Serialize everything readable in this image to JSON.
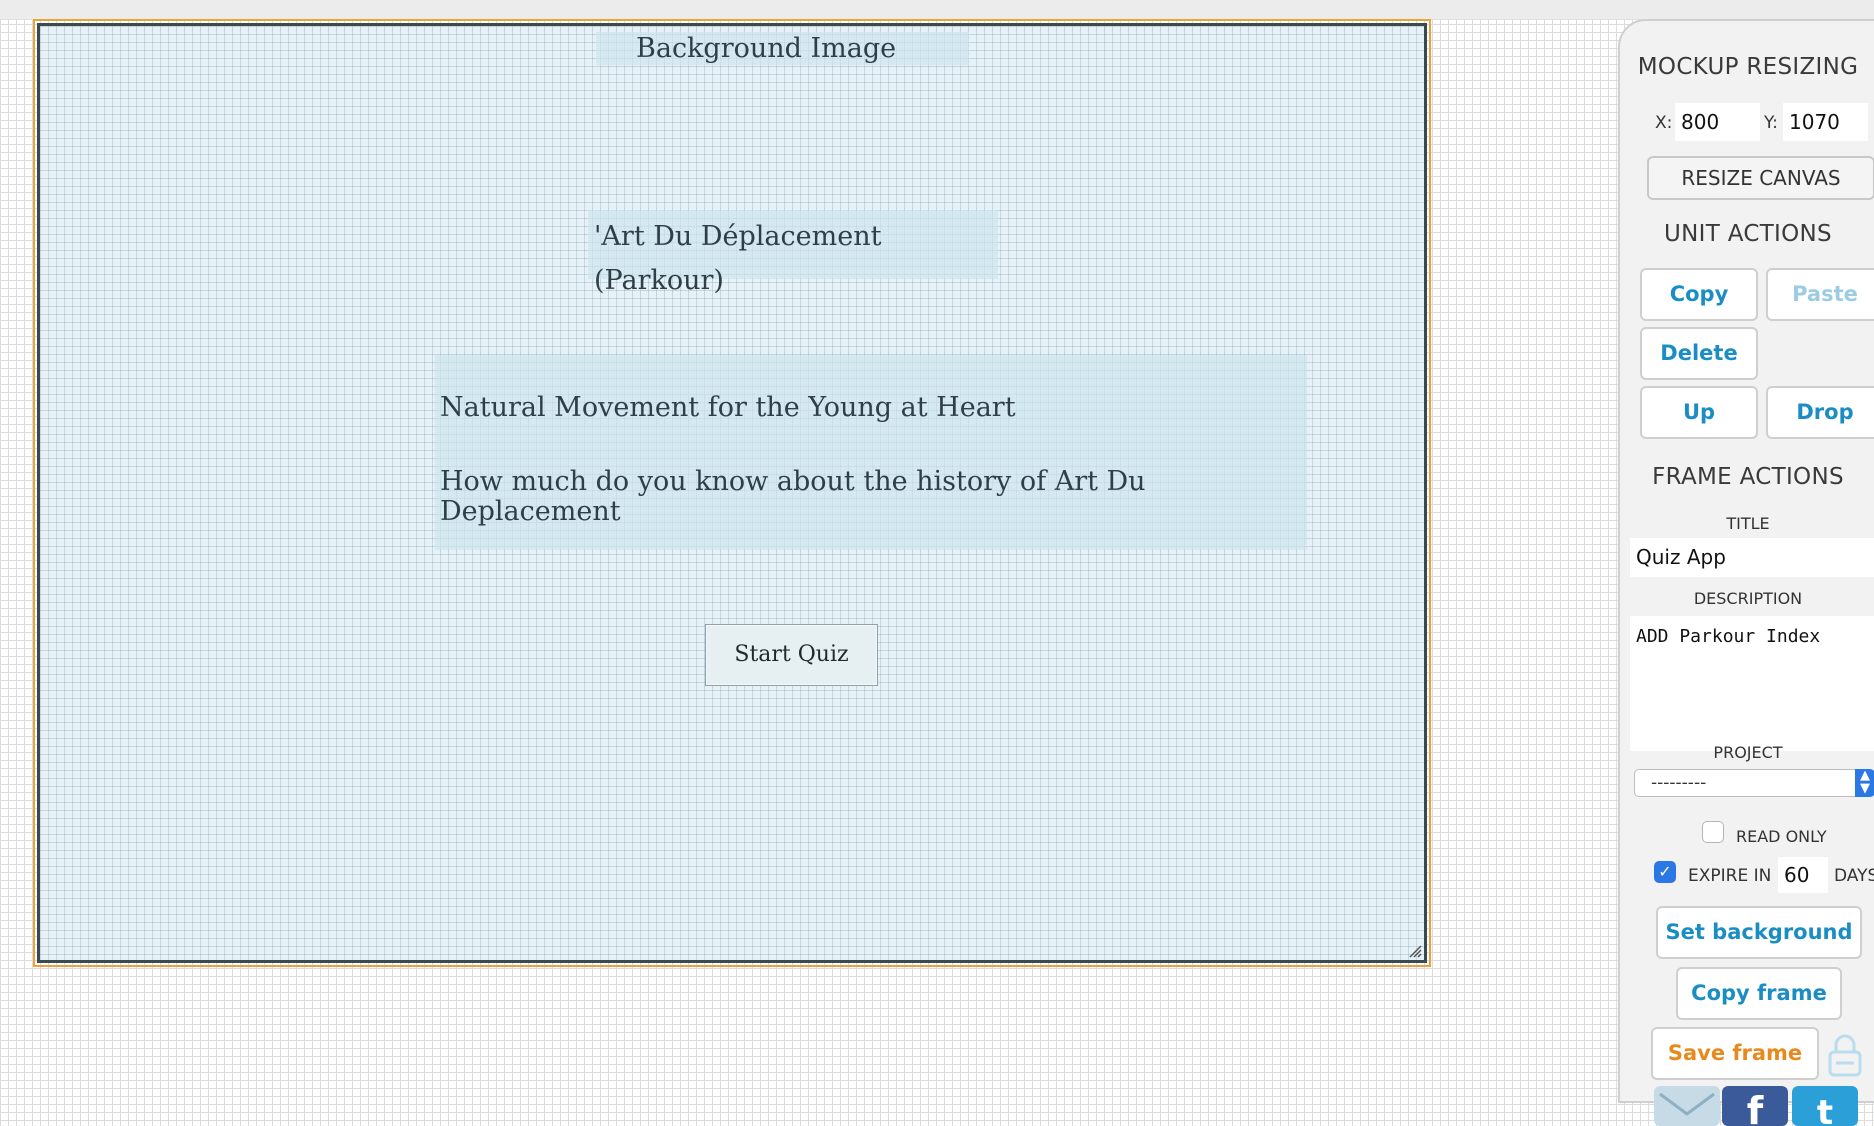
{
  "canvas": {
    "background_label": "Background Image",
    "title": "'Art Du Déplacement (Parkour)",
    "text_lines": [
      "Natural Movement for the Young at Heart",
      "How much do you know about the history of Art Du Deplacement"
    ],
    "start_button": "Start Quiz"
  },
  "panel": {
    "mockup_resizing": {
      "heading": "MOCKUP RESIZING",
      "x_label": "X:",
      "x_value": "800",
      "y_label": "Y:",
      "y_value": "1070",
      "resize_button": "RESIZE CANVAS"
    },
    "unit_actions": {
      "heading": "UNIT ACTIONS",
      "copy": "Copy",
      "paste": "Paste",
      "delete": "Delete",
      "up": "Up",
      "drop": "Drop"
    },
    "frame_actions": {
      "heading": "FRAME ACTIONS",
      "title_label": "TITLE",
      "title_value": "Quiz App",
      "description_label": "DESCRIPTION",
      "description_value": "ADD Parkour Index",
      "project_label": "PROJECT",
      "project_value": "---------",
      "read_only_label": "READ ONLY",
      "read_only_checked": false,
      "expire_label": "EXPIRE IN",
      "expire_value": "60",
      "expire_unit": "DAYS",
      "expire_checked": true,
      "set_background": "Set background",
      "copy_frame": "Copy frame",
      "save_frame": "Save frame"
    },
    "share_icons": [
      "email-icon",
      "facebook-icon",
      "twitter-icon"
    ]
  },
  "colors": {
    "accent_blue": "#1a8ec4",
    "accent_orange": "#e68a1e",
    "frame_border": "#e8a33a",
    "canvas_bg": "#e6f2f7",
    "checkbox_blue": "#2b78e4"
  }
}
